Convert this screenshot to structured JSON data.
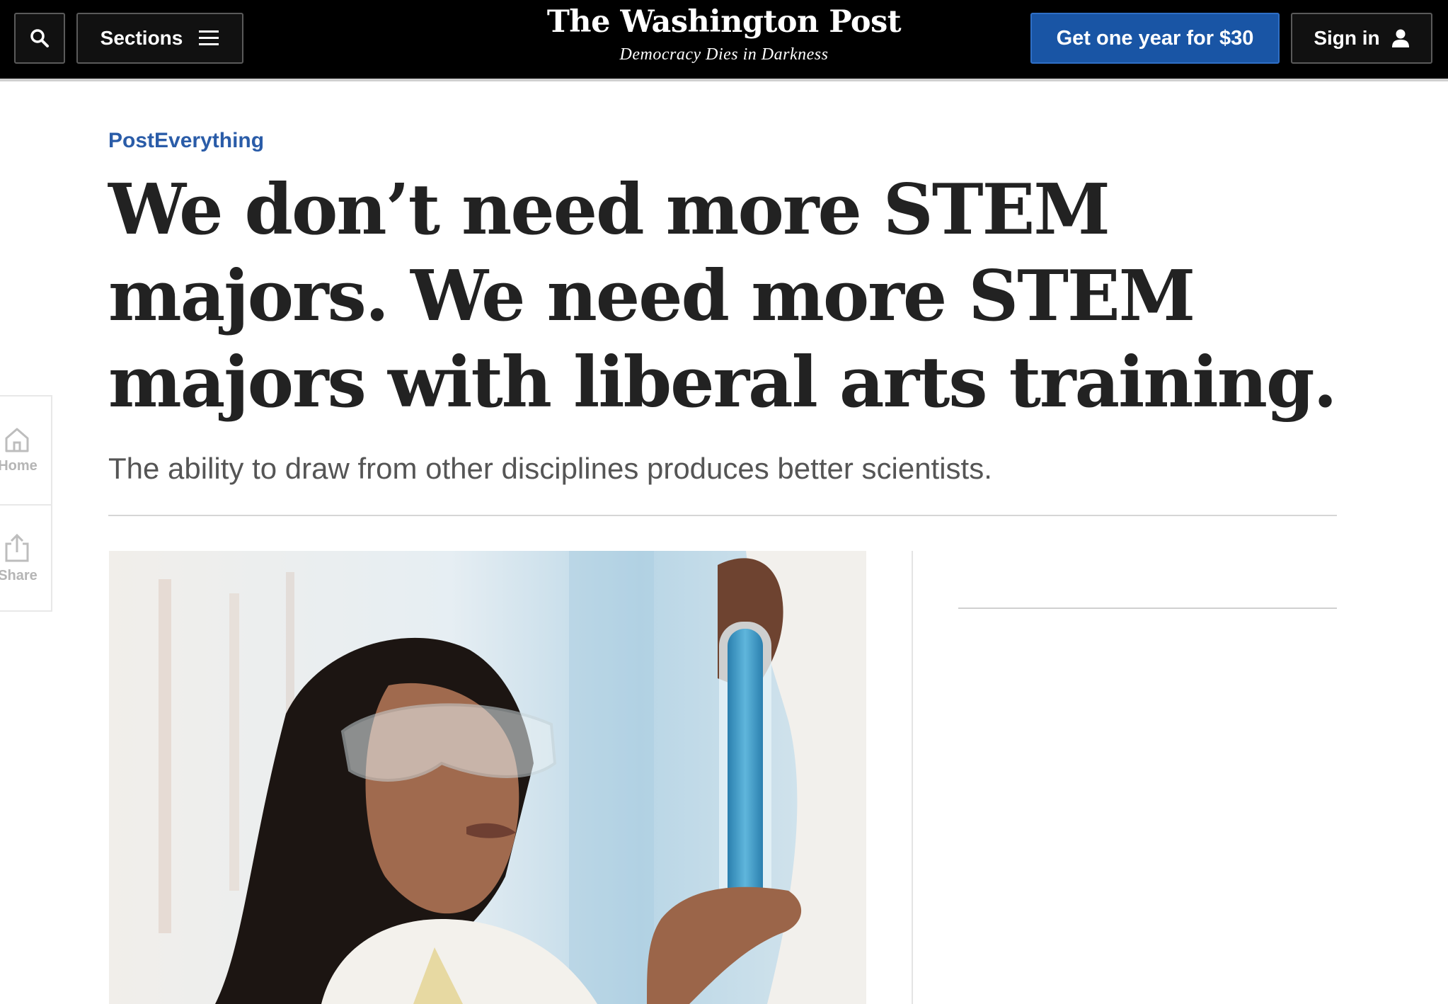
{
  "header": {
    "sections_label": "Sections",
    "logo": "The Washington Post",
    "tagline": "Democracy Dies in Darkness",
    "subscribe_label": "Get one year for $30",
    "signin_label": "Sign in"
  },
  "rail": {
    "home_label": "Home",
    "share_label": "Share"
  },
  "article": {
    "kicker": "PostEverything",
    "headline": "We don’t need more STEM majors. We need more STEM majors with liberal arts training.",
    "dek": "The ability to draw from other disciplines produces better scientists."
  },
  "icons": {
    "search": "search-icon",
    "menu": "hamburger-icon",
    "user": "user-icon",
    "home": "home-icon",
    "share": "share-icon"
  },
  "colors": {
    "topbar": "#000000",
    "subscribe": "#1955a5",
    "kicker": "#2a5ca8",
    "headline": "#222222",
    "dek": "#555555"
  }
}
